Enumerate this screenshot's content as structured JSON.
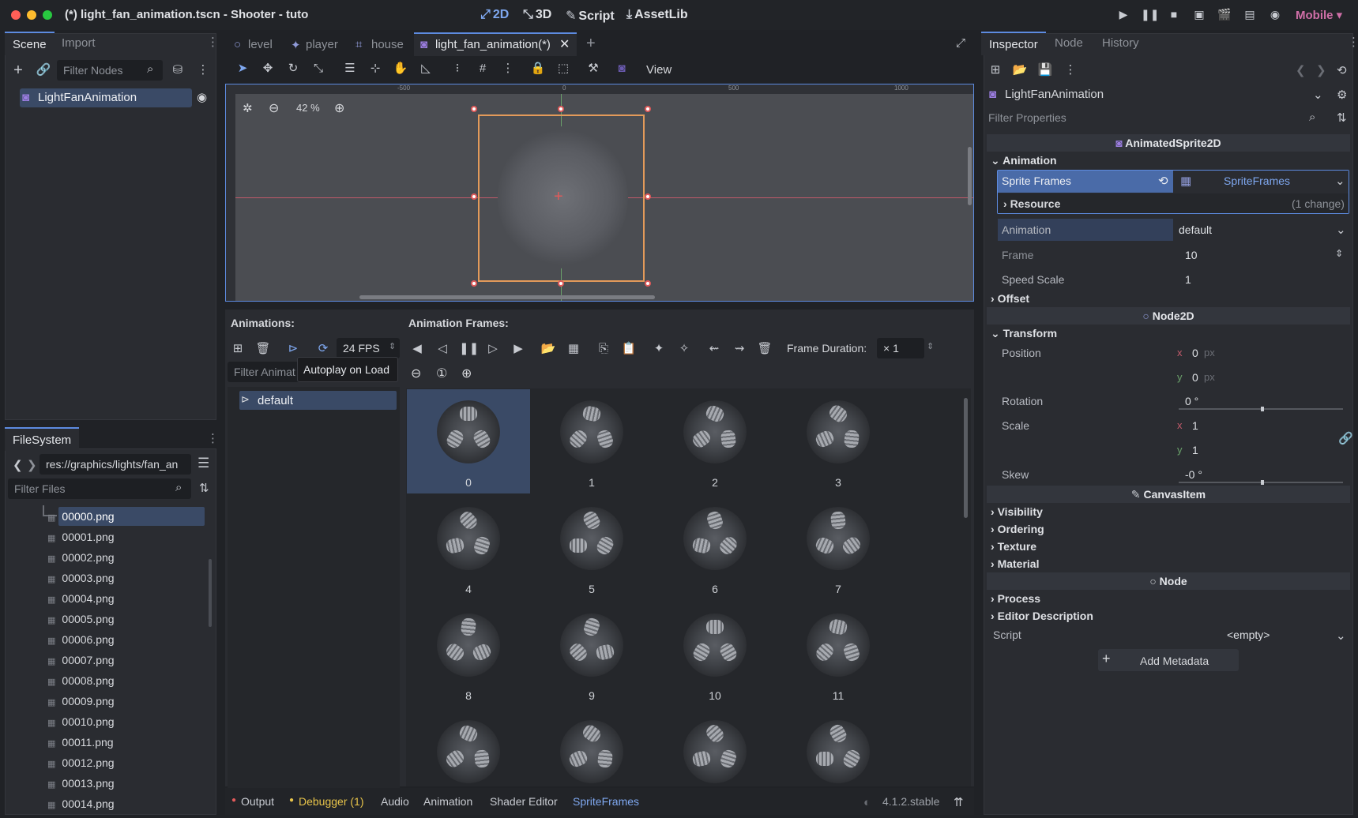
{
  "window": {
    "title": "(*) light_fan_animation.tscn - Shooter - tuto"
  },
  "topbar": {
    "modes": [
      {
        "label": "2D",
        "icon": "2d-icon"
      },
      {
        "label": "3D",
        "icon": "3d-icon"
      },
      {
        "label": "Script",
        "icon": "script-icon"
      },
      {
        "label": "AssetLib",
        "icon": "assetlib-icon"
      }
    ],
    "renderer": "Mobile"
  },
  "scene_dock": {
    "tabs": [
      "Scene",
      "Import"
    ],
    "filter_placeholder": "Filter Nodes",
    "root_node": "LightFanAnimation"
  },
  "filesystem": {
    "tab": "FileSystem",
    "path": "res://graphics/lights/fan_an",
    "filter_placeholder": "Filter Files",
    "files": [
      "00000.png",
      "00001.png",
      "00002.png",
      "00003.png",
      "00004.png",
      "00005.png",
      "00006.png",
      "00007.png",
      "00008.png",
      "00009.png",
      "00010.png",
      "00011.png",
      "00012.png",
      "00013.png",
      "00014.png"
    ]
  },
  "editor_tabs": [
    "level",
    "player",
    "house",
    "light_fan_animation(*)"
  ],
  "toolbar": {
    "view_label": "View"
  },
  "viewport": {
    "zoom": "42 %",
    "ruler_marks": [
      "-500",
      "0",
      "500",
      "1000"
    ]
  },
  "spriteframes": {
    "animations_label": "Animations:",
    "frames_label": "Animation Frames:",
    "fps": "24 FPS",
    "tooltip": "Autoplay on Load",
    "filter_placeholder": "Filter Animat",
    "animation_item": "default",
    "frame_duration_label": "Frame Duration:",
    "frame_duration_value": "× 1",
    "frames": [
      "0",
      "1",
      "2",
      "3",
      "4",
      "5",
      "6",
      "7",
      "8",
      "9",
      "10",
      "11"
    ]
  },
  "bottom_panel": {
    "tabs": [
      "Output",
      "Debugger (1)",
      "Audio",
      "Animation",
      "Shader Editor",
      "SpriteFrames"
    ],
    "version": "4.1.2.stable"
  },
  "inspector": {
    "tabs": [
      "Inspector",
      "Node",
      "History"
    ],
    "node_name": "LightFanAnimation",
    "filter_placeholder": "Filter Properties",
    "class_header": "AnimatedSprite2D",
    "animation_category": "Animation",
    "sprite_frames_label": "Sprite Frames",
    "sprite_frames_value": "SpriteFrames",
    "resource_label": "Resource",
    "resource_change": "(1 change)",
    "animation_label": "Animation",
    "animation_value": "default",
    "frame_label": "Frame",
    "frame_value": "10",
    "speed_scale_label": "Speed Scale",
    "speed_scale_value": "1",
    "offset_label": "Offset",
    "node2d_header": "Node2D",
    "transform_label": "Transform",
    "position_label": "Position",
    "position_x": "0",
    "position_y": "0",
    "px_unit": "px",
    "rotation_label": "Rotation",
    "rotation_value": "0 °",
    "scale_label": "Scale",
    "scale_x": "1",
    "scale_y": "1",
    "skew_label": "Skew",
    "skew_value": "-0 °",
    "canvasitem_header": "CanvasItem",
    "visibility_label": "Visibility",
    "ordering_label": "Ordering",
    "texture_label": "Texture",
    "material_label": "Material",
    "node_header": "Node",
    "process_label": "Process",
    "editor_desc_label": "Editor Description",
    "script_label": "Script",
    "script_value": "<empty>",
    "add_metadata_label": "Add Metadata",
    "x_axis": "x",
    "y_axis": "y"
  },
  "colors": {
    "accent": "#5d8be0",
    "selection": "#3a4a66",
    "gizmo": "#e05a5a",
    "sprite_outline": "#e39a5a"
  }
}
